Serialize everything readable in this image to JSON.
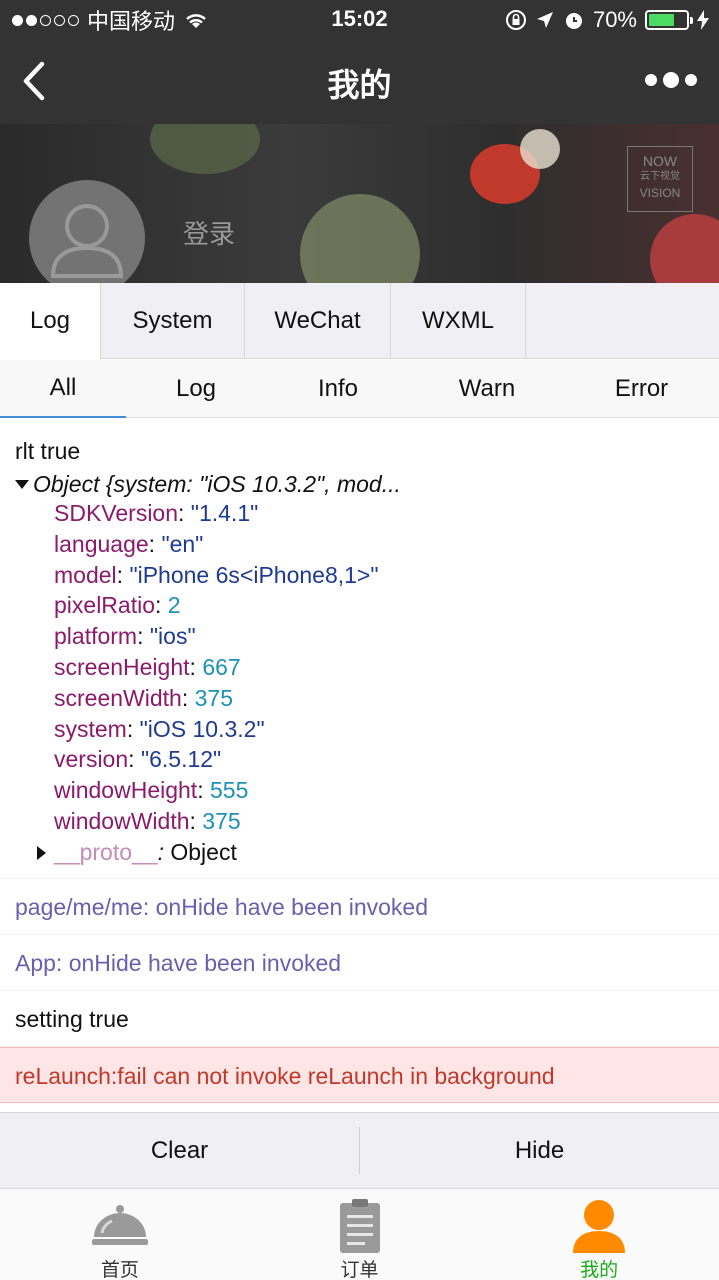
{
  "status_bar": {
    "carrier": "中国移动",
    "time": "15:02",
    "battery": "70%",
    "battery_level": 0.7
  },
  "nav": {
    "title": "我的"
  },
  "profile": {
    "login_label": "登录",
    "brand_lines": [
      "NOW",
      "云下视觉",
      "VISION"
    ]
  },
  "tabs_primary": [
    {
      "label": "Log",
      "active": true
    },
    {
      "label": "System",
      "active": false
    },
    {
      "label": "WeChat",
      "active": false
    },
    {
      "label": "WXML",
      "active": false
    }
  ],
  "tabs_filter": [
    {
      "label": "All",
      "active": true
    },
    {
      "label": "Log",
      "active": false
    },
    {
      "label": "Info",
      "active": false
    },
    {
      "label": "Warn",
      "active": false
    },
    {
      "label": "Error",
      "active": false
    }
  ],
  "log": {
    "first_line": "rlt true",
    "object_summary": "Object {system: \"iOS 10.3.2\", mod...",
    "props": [
      {
        "key": "SDKVersion",
        "value": "\"1.4.1\"",
        "type": "string"
      },
      {
        "key": "language",
        "value": "\"en\"",
        "type": "string"
      },
      {
        "key": "model",
        "value": "\"iPhone 6s<iPhone8,1>\"",
        "type": "string"
      },
      {
        "key": "pixelRatio",
        "value": "2",
        "type": "number"
      },
      {
        "key": "platform",
        "value": "\"ios\"",
        "type": "string"
      },
      {
        "key": "screenHeight",
        "value": "667",
        "type": "number"
      },
      {
        "key": "screenWidth",
        "value": "375",
        "type": "number"
      },
      {
        "key": "system",
        "value": "\"iOS 10.3.2\"",
        "type": "string"
      },
      {
        "key": "version",
        "value": "\"6.5.12\"",
        "type": "string"
      },
      {
        "key": "windowHeight",
        "value": "555",
        "type": "number"
      },
      {
        "key": "windowWidth",
        "value": "375",
        "type": "number"
      }
    ],
    "proto_key": "__proto__",
    "proto_value": "Object",
    "entries": [
      {
        "text": "page/me/me: onHide have been invoked",
        "level": "info"
      },
      {
        "text": "App: onHide have been invoked",
        "level": "info"
      },
      {
        "text": "setting true",
        "level": "log"
      },
      {
        "text": "reLaunch:fail can not invoke reLaunch in background",
        "level": "error"
      }
    ]
  },
  "actions": {
    "clear": "Clear",
    "hide": "Hide"
  },
  "tabbar": [
    {
      "label": "首页",
      "icon": "cloche-icon",
      "active": false
    },
    {
      "label": "订单",
      "icon": "clipboard-icon",
      "active": false
    },
    {
      "label": "我的",
      "icon": "user-icon",
      "active": true
    }
  ],
  "colors": {
    "accent": "#1aad19",
    "active_user": "#ff8a00",
    "error_bg": "#ffe5e5",
    "error_text": "#c0392b",
    "key": "#8b1a6b",
    "string": "#1f3a93",
    "number": "#1c91b6"
  }
}
